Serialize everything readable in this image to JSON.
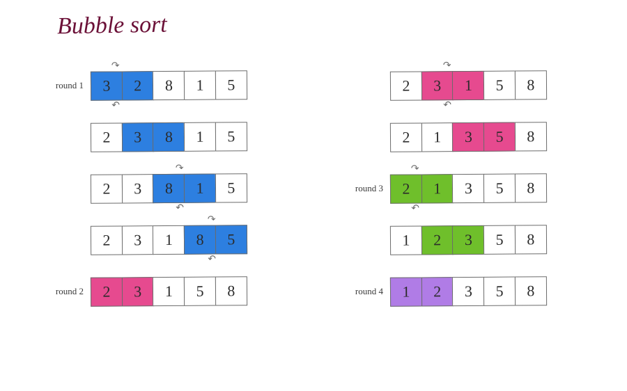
{
  "title": "Bubble sort",
  "colors": {
    "blue": "#2d7fe0",
    "pink": "#e64a8f",
    "green": "#6fbf2b",
    "purple": "#b07ce6"
  },
  "chart_data": {
    "type": "table",
    "title": "Bubble sort",
    "description": "Bubble sort step-by-step on array [3,2,8,1,5]; each step highlights the pair being compared and whether they swap.",
    "initial": [
      3,
      2,
      8,
      1,
      5
    ],
    "final": [
      1,
      2,
      3,
      5,
      8
    ],
    "rounds": [
      {
        "round": 1,
        "label": "round 1",
        "color": "blue",
        "steps": [
          {
            "array": [
              3,
              2,
              8,
              1,
              5
            ],
            "compare": [
              0,
              1
            ],
            "swap": true
          },
          {
            "array": [
              2,
              3,
              8,
              1,
              5
            ],
            "compare": [
              1,
              2
            ],
            "swap": false
          },
          {
            "array": [
              2,
              3,
              8,
              1,
              5
            ],
            "compare": [
              2,
              3
            ],
            "swap": true
          },
          {
            "array": [
              2,
              3,
              1,
              8,
              5
            ],
            "compare": [
              3,
              4
            ],
            "swap": true
          }
        ]
      },
      {
        "round": 2,
        "label": "round 2",
        "color": "pink",
        "steps": [
          {
            "array": [
              2,
              3,
              1,
              5,
              8
            ],
            "compare": [
              0,
              1
            ],
            "swap": false
          },
          {
            "array": [
              2,
              3,
              1,
              5,
              8
            ],
            "compare": [
              1,
              2
            ],
            "swap": true
          },
          {
            "array": [
              2,
              1,
              3,
              5,
              8
            ],
            "compare": [
              2,
              3
            ],
            "swap": false
          }
        ]
      },
      {
        "round": 3,
        "label": "round 3",
        "color": "green",
        "steps": [
          {
            "array": [
              2,
              1,
              3,
              5,
              8
            ],
            "compare": [
              0,
              1
            ],
            "swap": true
          },
          {
            "array": [
              1,
              2,
              3,
              5,
              8
            ],
            "compare": [
              1,
              2
            ],
            "swap": false
          }
        ]
      },
      {
        "round": 4,
        "label": "round 4",
        "color": "purple",
        "steps": [
          {
            "array": [
              1,
              2,
              3,
              5,
              8
            ],
            "compare": [
              0,
              1
            ],
            "swap": false
          }
        ]
      }
    ]
  },
  "layout": {
    "left_count": 5
  }
}
